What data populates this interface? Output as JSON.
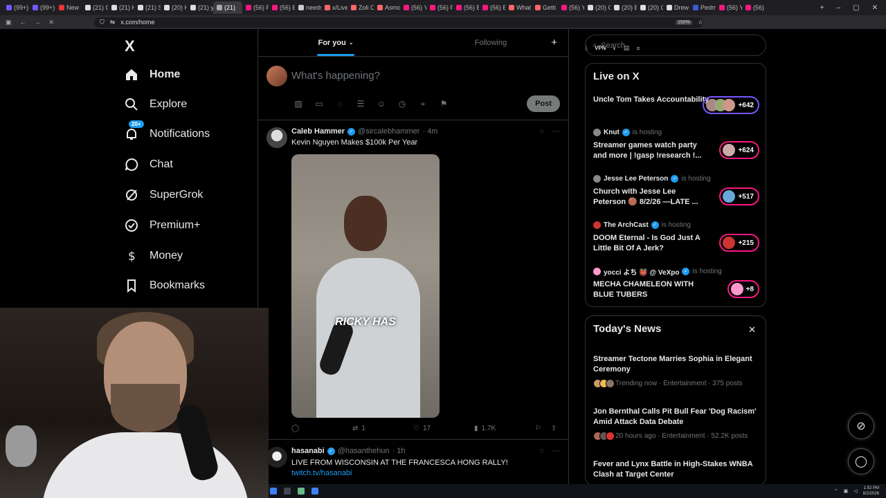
{
  "browser": {
    "tabs": [
      "(99+)",
      "(99+)",
      "New",
      "(21) C",
      "(21) H",
      "(21) S",
      "(20) H",
      "(21) y",
      "(21)",
      "(56) P",
      "(56) E",
      "needs",
      "x/Live",
      "Zoli C",
      "Asmo",
      "(56) Y",
      "(56) P",
      "(56) B",
      "(56) B",
      "What",
      "Getti",
      "(56) Y",
      "(20) C",
      "(20) B",
      "(20) C",
      "Drew",
      "Pedm",
      "(56) Y",
      "(56)"
    ],
    "url": "x.com/home",
    "zoom": "150%",
    "vpn_label": "VPN"
  },
  "nav": {
    "logo": "X",
    "notif_badge": "20+",
    "items": [
      {
        "label": "Home"
      },
      {
        "label": "Explore"
      },
      {
        "label": "Notifications"
      },
      {
        "label": "Chat"
      },
      {
        "label": "SuperGrok"
      },
      {
        "label": "Premium+"
      },
      {
        "label": "Money"
      },
      {
        "label": "Bookmarks"
      }
    ]
  },
  "feed": {
    "tabs": [
      "For you",
      "Following"
    ],
    "composer_placeholder": "What's happening?",
    "post_button": "Post",
    "tweet1": {
      "name": "Caleb Hammer",
      "handle": "@sircalebhammer",
      "time": "· 4m",
      "text": "Kevin Nguyen Makes $100k Per Year",
      "video_caption": "RICKY HAS",
      "retweets": "1",
      "likes": "17",
      "views": "1.7K"
    },
    "tweet2": {
      "name": "hasanabi",
      "handle": "@hasanthehun",
      "time": "· 1h",
      "text": "LIVE FROM WISCONSIN AT THE FRANCESCA HONG RALLY!",
      "link": "twitch.tv/hasanabi"
    }
  },
  "sidebar": {
    "search_placeholder": "Search",
    "live_title": "Live on X",
    "live": [
      {
        "host": "",
        "status": "",
        "title": "Uncle Tom Takes Accountability",
        "count": "+642",
        "color": "#7856ff"
      },
      {
        "host": "Knut",
        "status": "is hosting",
        "title": "Streamer games watch party and more | !gasp !research !...",
        "count": "+624",
        "color": "#f91880"
      },
      {
        "host": "Jesse Lee Peterson",
        "status": "is hosting",
        "title": "Church with Jesse Lee Peterson 🟤 8/2/26 —LATE ...",
        "count": "+517",
        "color": "#f91880"
      },
      {
        "host": "The ArchCast",
        "status": "is hosting",
        "title": "DOOM Eternal - Is God Just A Little Bit Of A Jerk?",
        "count": "+215",
        "color": "#f91880"
      },
      {
        "host": "yocci よち 👹 @ VeXpo",
        "status": "is hosting",
        "title": "MECHA CHAMELEON WITH BLUE TUBERS",
        "count": "+8",
        "color": "#f91880"
      }
    ],
    "news_title": "Today's News",
    "news": [
      {
        "title": "Streamer Tectone Marries Sophia in Elegant Ceremony",
        "meta": "Trending now · Entertainment · 375 posts"
      },
      {
        "title": "Jon Bernthal Calls Pit Bull Fear 'Dog Racism' Amid Attack Data Debate",
        "meta": "20 hours ago · Entertainment · 52.2K posts"
      },
      {
        "title": "Fever and Lynx Battle in High-Stakes WNBA Clash at Target Center",
        "meta": ""
      }
    ]
  },
  "taskbar": {
    "time": "1:52 PM",
    "date": "8/2/2026"
  }
}
